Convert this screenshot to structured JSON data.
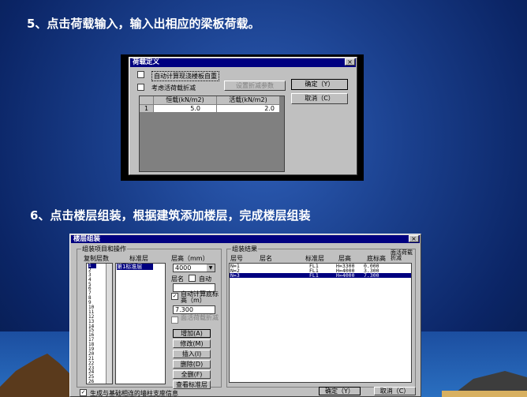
{
  "slide": {
    "heading_step5": "5、点击荷载输入，输入出相应的梁板荷载。",
    "heading_step6": "6、点击楼层组装，根据建筑添加楼层，完成楼层组装"
  },
  "load_dialog": {
    "title": "荷载定义",
    "close_glyph": "×",
    "auto_selfweight_label": "自动计算现浇楼板自重",
    "live_reduction_label": "考虑活荷载折减",
    "reduction_params_button": "设置折减参数",
    "ok_button": "确定（Y）",
    "cancel_button": "取消（C）",
    "table": {
      "headers": [
        "恒载(kN/m2)",
        "活载(kN/m2)"
      ],
      "rows": [
        {
          "index": "1",
          "dead": "5.0",
          "live": "2.0"
        }
      ]
    }
  },
  "floor_dialog": {
    "title": "楼层组装",
    "close_glyph": "×",
    "ops_group_title": "组装项目和操作",
    "col_copy_count": "复制层数",
    "col_std_floor": "标准层",
    "col_height": "层高（mm）",
    "copy_counts": [
      "1",
      "2",
      "3",
      "4",
      "5",
      "6",
      "7",
      "8",
      "9",
      "10",
      "11",
      "12",
      "13",
      "14",
      "15",
      "16",
      "17",
      "18",
      "19",
      "20",
      "21",
      "22",
      "23",
      "24",
      "25",
      "26"
    ],
    "std_floor_items": [
      "第1标准层"
    ],
    "height_value": "4000",
    "floor_name_label": "层名",
    "auto_label": "自动",
    "auto_base_elev_label": "自动计算底标高（m）",
    "base_elev_value": "7.300",
    "slab_rotate_label": "面活荷载折减",
    "add_button": "增加(A)",
    "modify_button": "修改(M)",
    "insert_button": "插入(I)",
    "delete_button": "删除(D)",
    "clear_button": "全删(F)",
    "view_std_button": "查看标准层",
    "result_group_title": "组装结果",
    "result_headers": {
      "floor_no": "层号",
      "floor_name": "层名",
      "std_floor": "标准层",
      "height": "层高",
      "base_elev": "底标高",
      "live_reduce": "面活荷载折减"
    },
    "result_rows": [
      {
        "no": "N=1",
        "std": "FL1",
        "height": "H=3300",
        "elev": "0.000"
      },
      {
        "no": "N=2",
        "std": "FL1",
        "height": "H=4000",
        "elev": "3.300"
      },
      {
        "no": "N=3",
        "std": "FL1",
        "height": "H=4000",
        "elev": "7.300"
      }
    ],
    "foundation_label": "生成与基础相连的墙柱支座信息",
    "ok_button": "确定（Y）",
    "cancel_button": "取消（C）"
  },
  "colors": {
    "titlebar": "#000080",
    "dialog_bg": "#c0c0c0"
  }
}
